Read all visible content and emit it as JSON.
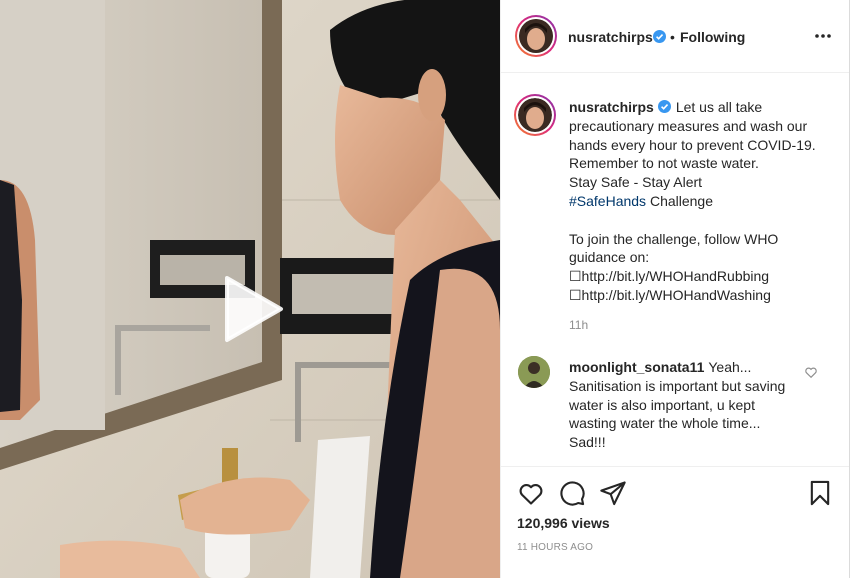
{
  "post": {
    "username": "nusratchirps",
    "separator": "•",
    "follow_status": "Following",
    "more_options": "...",
    "caption_line1": "Let us all take precautionary measures and wash our hands every hour to prevent COVID-19. Remember to not waste water.",
    "caption_line2": "Stay Safe - Stay Alert",
    "hashtag": "#SafeHands",
    "hashtag_suffix": " Challenge",
    "caption_line3": "To join the challenge, follow WHO guidance on:",
    "link1": "☐http://bit.ly/WHOHandRubbing",
    "link2": "☐http://bit.ly/WHOHandWashing",
    "caption_time": "11h",
    "views": "120,996 views",
    "timestamp": "11 HOURS AGO"
  },
  "comment": {
    "username": "moonlight_sonata11",
    "text": "Yeah... Sanitisation is important but saving water is also important, u kept wasting water the whole time... Sad!!!"
  },
  "icons": {
    "verified": "verified-badge-icon",
    "more": "more-options-icon",
    "play": "play-icon",
    "like": "heart-icon",
    "comment": "comment-icon",
    "share": "share-icon",
    "save": "bookmark-icon"
  },
  "colors": {
    "verified": "#3897f0",
    "link": "#00376b",
    "muted": "#8e8e8e",
    "text": "#262626"
  }
}
